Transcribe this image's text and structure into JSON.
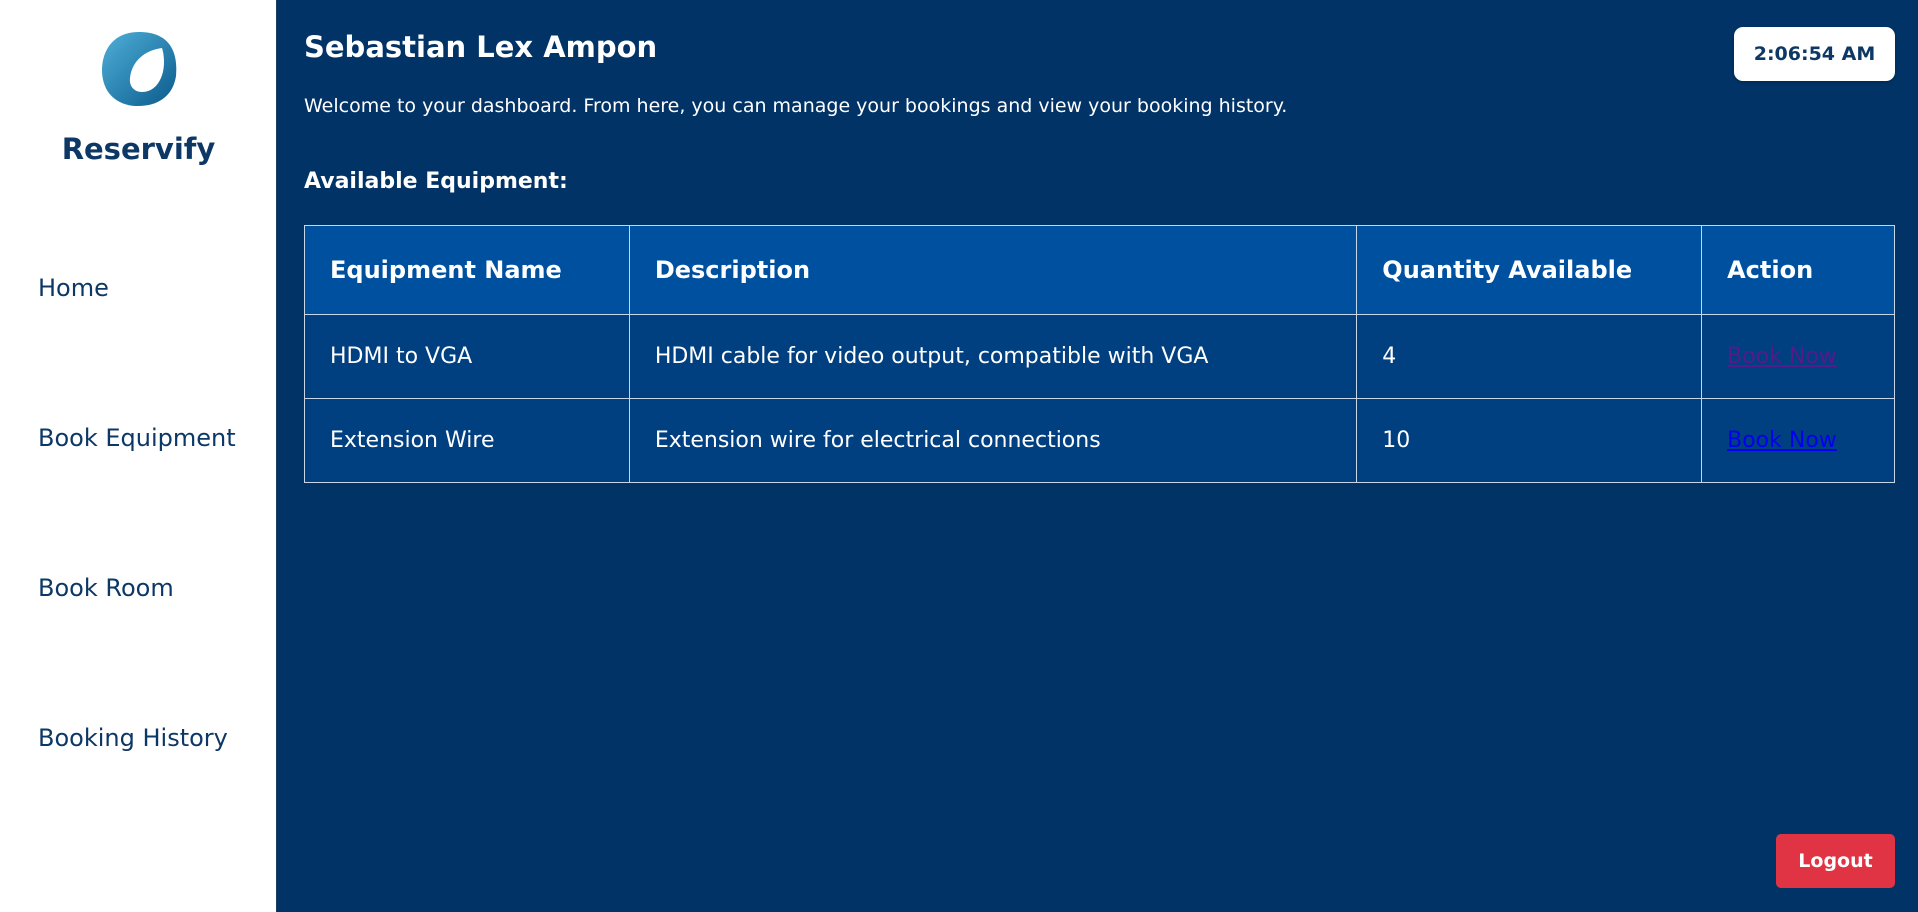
{
  "brand": {
    "name": "Reservify",
    "logo_icon": "leaf-swoosh-icon"
  },
  "sidebar": {
    "items": [
      {
        "label": "Home"
      },
      {
        "label": "Book Equipment"
      },
      {
        "label": "Book Room"
      },
      {
        "label": "Booking History"
      }
    ]
  },
  "header": {
    "user_name": "Sebastian Lex Ampon",
    "welcome": "Welcome to your dashboard. From here, you can manage your bookings and view your booking history.",
    "clock": "2:06:54 AM"
  },
  "equipment": {
    "title": "Available Equipment:",
    "columns": [
      "Equipment Name",
      "Description",
      "Quantity Available",
      "Action"
    ],
    "rows": [
      {
        "name": "HDMI to VGA",
        "description": "HDMI cable for video output, compatible with VGA",
        "quantity": "4",
        "action": "Book Now",
        "link_state": "visited"
      },
      {
        "name": "Extension Wire",
        "description": "Extension wire for electrical connections",
        "quantity": "10",
        "action": "Book Now",
        "link_state": "unvisited"
      }
    ]
  },
  "logout_label": "Logout",
  "colors": {
    "background": "#013366",
    "sidebar": "#ffffff",
    "brand_text": "#0d3866",
    "table_header": "#0050a0",
    "table_cell": "#003f80",
    "logout": "#e03444",
    "link": "#0000ee",
    "link_visited": "#551a8b"
  }
}
